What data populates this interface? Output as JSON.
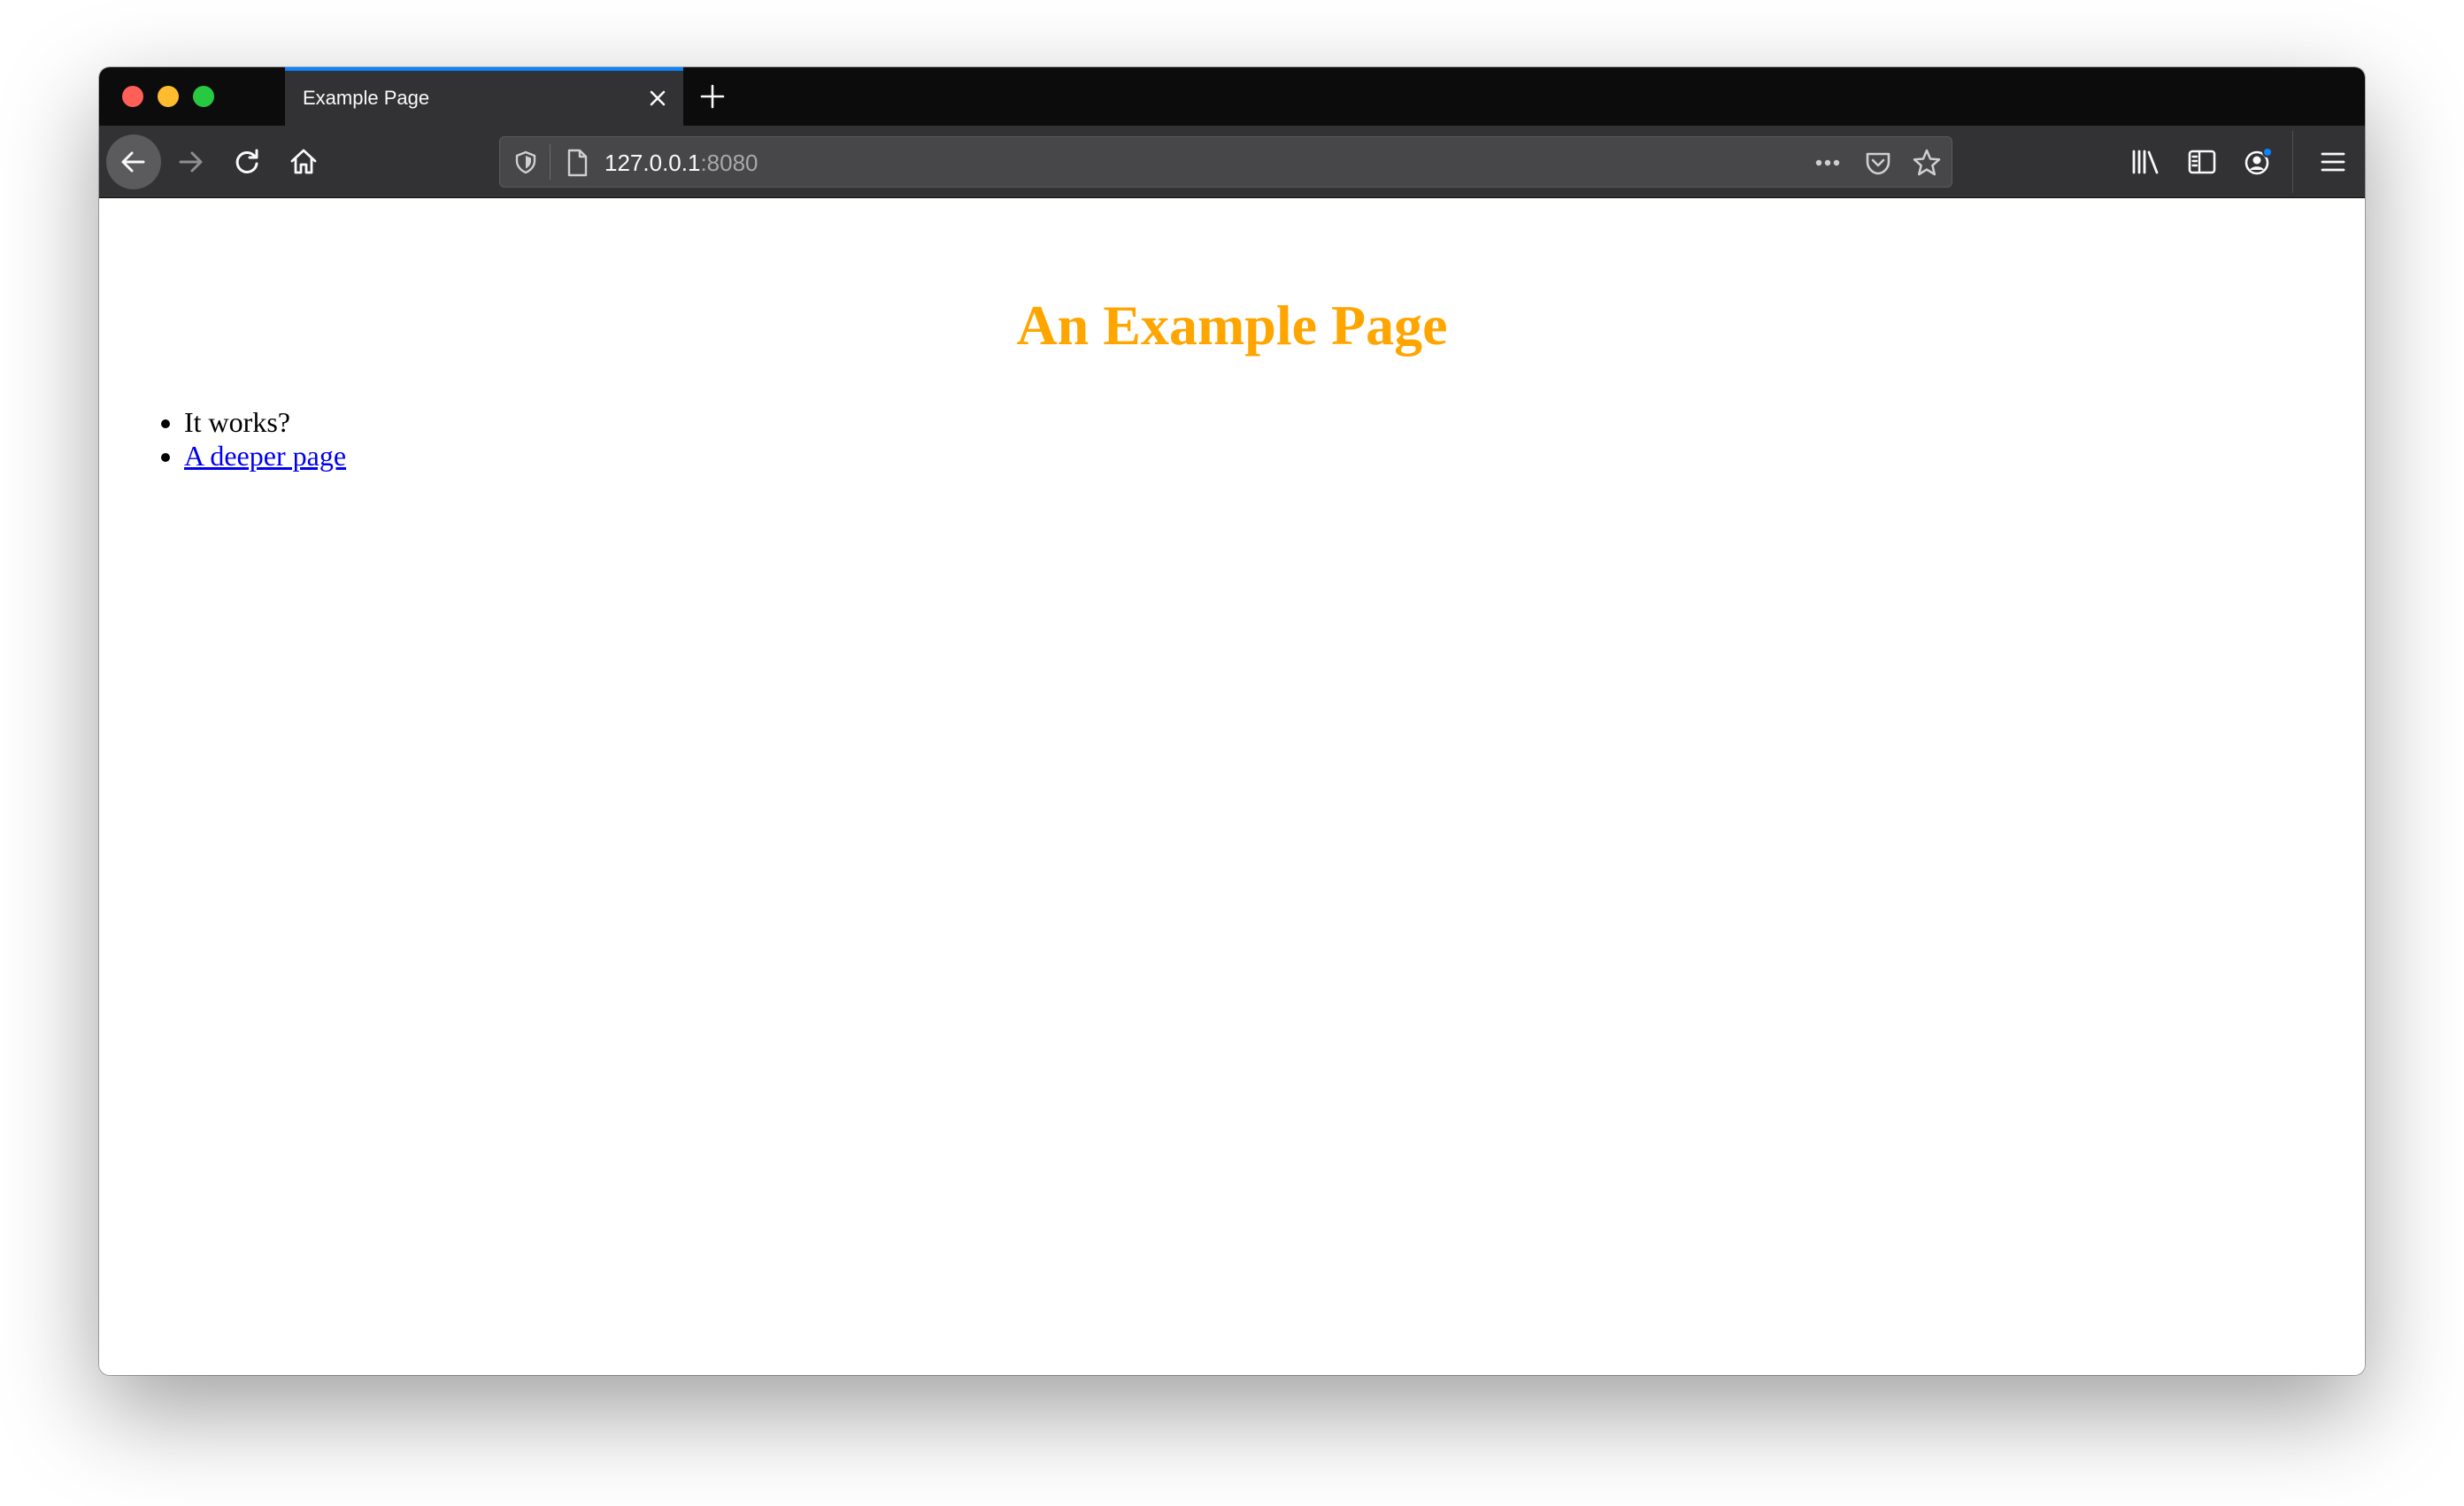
{
  "browser": {
    "tab": {
      "title": "Example Page",
      "accent_color": "#0a84ff",
      "close_icon": "close-icon"
    },
    "new_tab_icon": "plus-icon",
    "toolbar": {
      "back_icon": "arrow-left-icon",
      "forward_icon": "arrow-right-icon",
      "reload_icon": "reload-icon",
      "home_icon": "home-icon",
      "library_icon": "library-icon",
      "sidebar_icon": "sidebar-icon",
      "account_icon": "account-icon",
      "menu_icon": "hamburger-menu-icon"
    },
    "address_bar": {
      "host": "127.0.0.1",
      "port": ":8080",
      "tracking_icon": "shield-icon",
      "page_icon": "page-icon",
      "actions": [
        "more-icon",
        "pocket-icon",
        "star-icon"
      ]
    },
    "traffic_lights": [
      "#fe5f57",
      "#febc2e",
      "#28c840"
    ]
  },
  "page": {
    "heading": "An Example Page",
    "heading_color": "#ffa500",
    "list": [
      {
        "text": "It works?",
        "link": false
      },
      {
        "text": "A deeper page",
        "link": true
      }
    ]
  }
}
